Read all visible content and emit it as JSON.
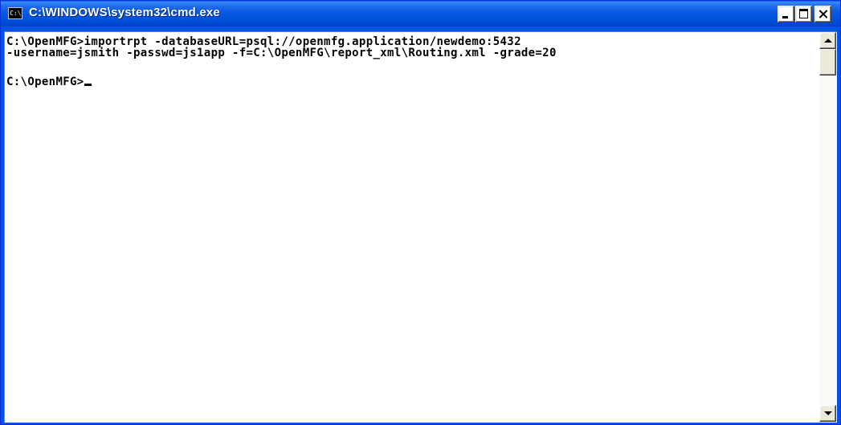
{
  "window": {
    "title": "C:\\WINDOWS\\system32\\cmd.exe",
    "icon": "cmd-icon",
    "icon_glyph": "C:\\"
  },
  "titlebar_buttons": {
    "minimize": "minimize-icon",
    "maximize": "maximize-icon",
    "close": "close-icon"
  },
  "console": {
    "lines": [
      "C:\\OpenMFG>importrpt -databaseURL=psql://openmfg.application/newdemo:5432",
      "-username=jsmith -passwd=js1app -f=C:\\OpenMFG\\report_xml\\Routing.xml -grade=20",
      "C:\\OpenMFG>"
    ],
    "background": "#ffffff",
    "foreground": "#000000"
  },
  "scrollbar": {
    "up_icon": "scroll-up-arrow-icon",
    "down_icon": "scroll-down-arrow-icon"
  },
  "colors": {
    "titlebar": "#0054e3",
    "chrome": "#ece9d8"
  }
}
